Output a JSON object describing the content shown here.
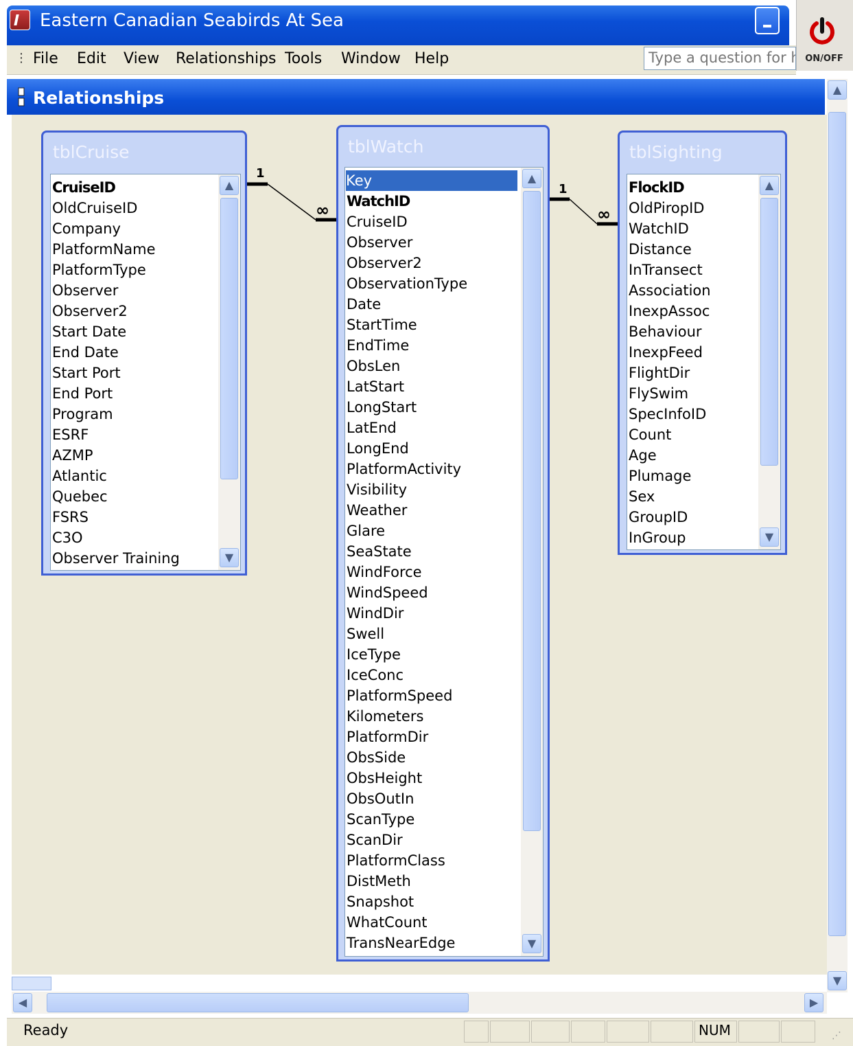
{
  "window": {
    "title": "Eastern Canadian Seabirds At Sea",
    "onoff_label": "ON/OFF"
  },
  "menu": {
    "items": [
      "File",
      "Edit",
      "View",
      "Relationships",
      "Tools",
      "Window",
      "Help"
    ],
    "help_placeholder": "Type a question for help"
  },
  "relationships_window": {
    "title": "Relationships"
  },
  "tables": {
    "cruise": {
      "name": "tblCruise",
      "fields": [
        "CruiseID",
        "OldCruiseID",
        "Company",
        "PlatformName",
        "PlatformType",
        "Observer",
        "Observer2",
        "Start Date",
        "End Date",
        "Start Port",
        "End Port",
        "Program",
        "ESRF",
        "AZMP",
        "Atlantic",
        "Quebec",
        "FSRS",
        "C3O",
        "Observer Training"
      ]
    },
    "watch": {
      "name": "tblWatch",
      "fields": [
        "Key",
        "WatchID",
        "CruiseID",
        "Observer",
        "Observer2",
        "ObservationType",
        "Date",
        "StartTime",
        "EndTime",
        "ObsLen",
        "LatStart",
        "LongStart",
        "LatEnd",
        "LongEnd",
        "PlatformActivity",
        "Visibility",
        "Weather",
        "Glare",
        "SeaState",
        "WindForce",
        "WindSpeed",
        "WindDir",
        "Swell",
        "IceType",
        "IceConc",
        "PlatformSpeed",
        "Kilometers",
        "PlatformDir",
        "ObsSide",
        "ObsHeight",
        "ObsOutIn",
        "ScanType",
        "ScanDir",
        "PlatformClass",
        "DistMeth",
        "Snapshot",
        "WhatCount",
        "TransNearEdge"
      ]
    },
    "sighting": {
      "name": "tblSighting",
      "fields": [
        "FlockID",
        "OldPiropID",
        "WatchID",
        "Distance",
        "InTransect",
        "Association",
        "InexpAssoc",
        "Behaviour",
        "InexpFeed",
        "FlightDir",
        "FlySwim",
        "SpecInfoID",
        "Count",
        "Age",
        "Plumage",
        "Sex",
        "GroupID",
        "InGroup"
      ]
    }
  },
  "relations": [
    {
      "one": "1",
      "many": "∞"
    },
    {
      "one": "1",
      "many": "∞"
    }
  ],
  "status": {
    "text": "Ready",
    "num": "NUM"
  },
  "colors": {
    "titlebar": "#0a4fd6",
    "selection": "#316ac5",
    "canvas": "#ece9d8"
  }
}
